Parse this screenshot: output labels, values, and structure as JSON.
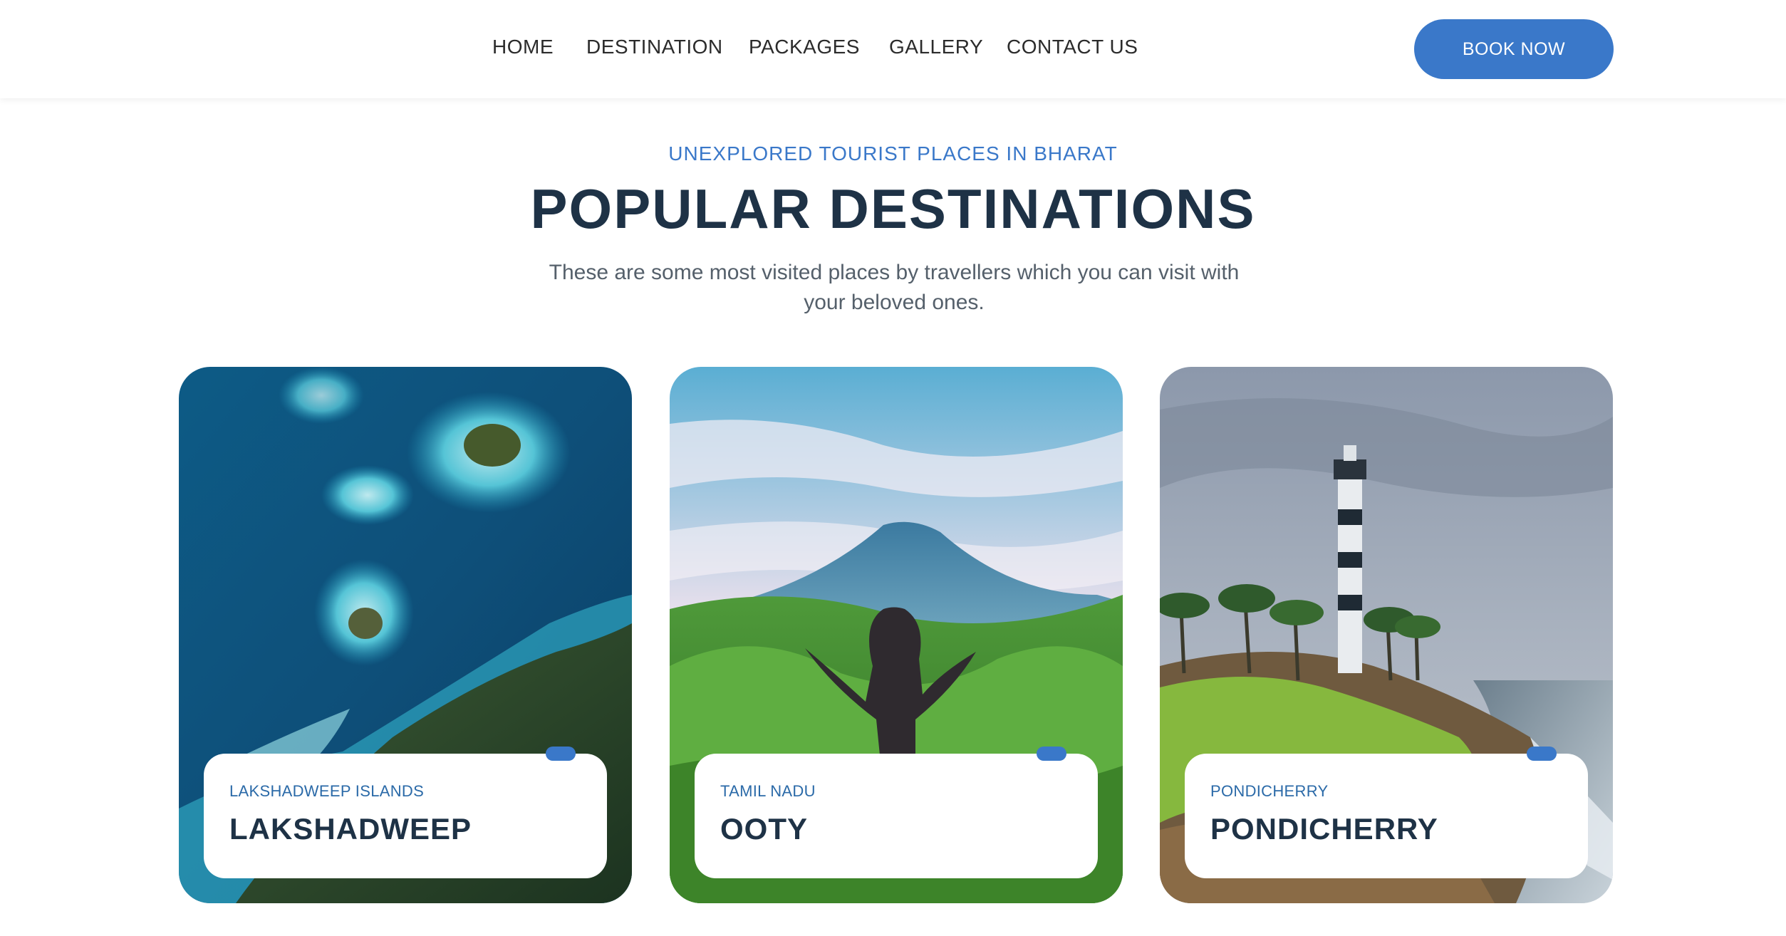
{
  "nav": {
    "items": [
      {
        "label": "HOME"
      },
      {
        "label": "DESTINATION"
      },
      {
        "label": "PACKAGES"
      },
      {
        "label": "GALLERY"
      },
      {
        "label": "CONTACT US"
      }
    ],
    "cta_label": "BOOK NOW"
  },
  "intro": {
    "eyebrow": "UNEXPLORED TOURIST PLACES IN BHARAT",
    "title": "POPULAR DESTINATIONS",
    "subtitle": "These are some most visited places by travellers which you can visit with your beloved ones."
  },
  "cards": [
    {
      "region": "LAKSHADWEEP ISLANDS",
      "name": "LAKSHADWEEP",
      "image": "aerial-islands-photo"
    },
    {
      "region": "TAMIL NADU",
      "name": "OOTY",
      "image": "mountain-hiker-photo"
    },
    {
      "region": "PONDICHERRY",
      "name": "PONDICHERRY",
      "image": "lighthouse-coast-photo"
    }
  ],
  "colors": {
    "accent": "#3a78c9",
    "heading": "#1e3246",
    "body_text": "#55606b",
    "nav_text": "#2b2b2b"
  }
}
